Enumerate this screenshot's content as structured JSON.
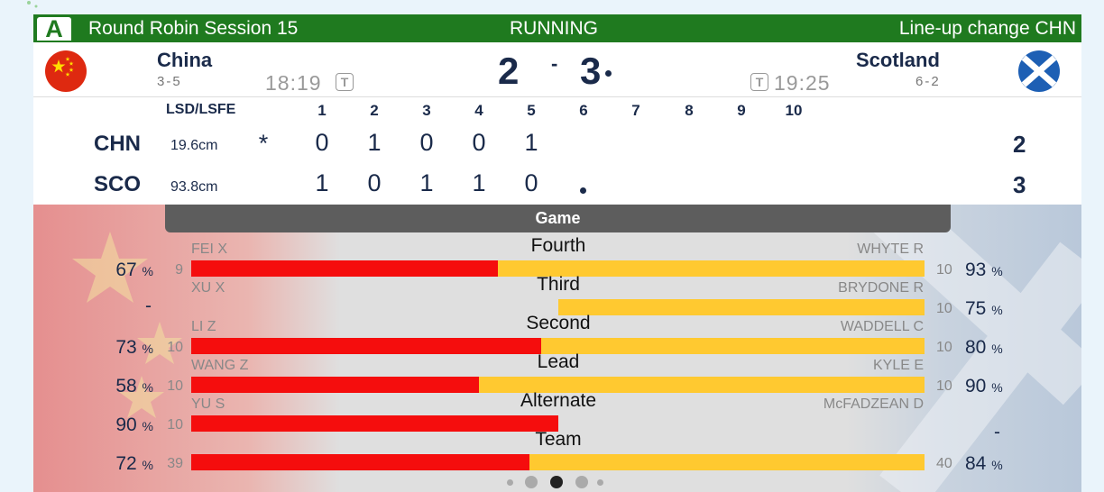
{
  "header": {
    "sheet": "A",
    "session": "Round Robin Session 15",
    "status": "RUNNING",
    "notice": "Line-up change CHN"
  },
  "home": {
    "name": "China",
    "record": "3-5",
    "clock": "18:19",
    "timeout_icon": "T",
    "score": "2",
    "flag": "china-flag-icon"
  },
  "away": {
    "name": "Scotland",
    "record": "6-2",
    "clock": "19:25",
    "timeout_icon": "T",
    "score": "3",
    "flag": "scotland-flag-icon",
    "has_hammer": true
  },
  "score_separator": "-",
  "linescore": {
    "lsd_header": "LSD/LSFE",
    "ends": [
      "1",
      "2",
      "3",
      "4",
      "5",
      "6",
      "7",
      "8",
      "9",
      "10"
    ],
    "rows": [
      {
        "team": "CHN",
        "lsd": "19.6cm",
        "marker": "*",
        "scores": [
          "0",
          "1",
          "0",
          "0",
          "1"
        ],
        "total": "2"
      },
      {
        "team": "SCO",
        "lsd": "93.8cm",
        "marker": "",
        "scores": [
          "1",
          "0",
          "1",
          "1",
          "0"
        ],
        "hammer_end": 6,
        "total": "3"
      }
    ]
  },
  "stats": {
    "tab_label": "Game",
    "unit": "%",
    "rows": [
      {
        "position": "Fourth",
        "left_player": "FEI X",
        "right_player": "WHYTE R",
        "left_pct": "67",
        "left_shots": "9",
        "right_pct": "93",
        "right_shots": "10",
        "left_share": 0.418
      },
      {
        "position": "Third",
        "left_player": "XU X",
        "right_player": "BRYDONE R",
        "left_pct": "-",
        "left_shots": "",
        "right_pct": "75",
        "right_shots": "10",
        "left_share": 0.5
      },
      {
        "position": "Second",
        "left_player": "LI Z",
        "right_player": "WADDELL C",
        "left_pct": "73",
        "left_shots": "10",
        "right_pct": "80",
        "right_shots": "10",
        "left_share": 0.477
      },
      {
        "position": "Lead",
        "left_player": "WANG Z",
        "right_player": "KYLE E",
        "left_pct": "58",
        "left_shots": "10",
        "right_pct": "90",
        "right_shots": "10",
        "left_share": 0.392
      },
      {
        "position": "Alternate",
        "left_player": "YU S",
        "right_player": "McFADZEAN D",
        "left_pct": "90",
        "left_shots": "10",
        "right_pct": "-",
        "right_shots": "",
        "left_share": 0.5
      },
      {
        "position": "Team",
        "left_player": "",
        "right_player": "",
        "left_pct": "72",
        "left_shots": "39",
        "right_pct": "84",
        "right_shots": "40",
        "left_share": 0.461
      }
    ]
  },
  "pager": {
    "count": 5,
    "active_index": 2
  },
  "colors": {
    "header_green": "#1f7a1f",
    "navy_text": "#1a2a4a",
    "home_bar": "#f50d0d",
    "away_bar": "#ffc930",
    "tab_gray": "#5d5d5d"
  }
}
